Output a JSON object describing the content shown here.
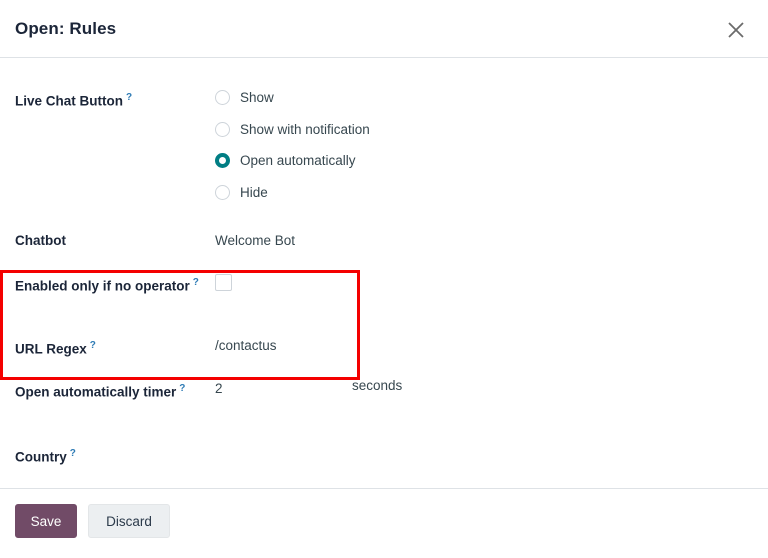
{
  "dialog": {
    "title": "Open: Rules",
    "close_icon": "close-icon"
  },
  "form": {
    "live_chat_button": {
      "label": "Live Chat Button",
      "help": "?",
      "options": [
        {
          "label": "Show",
          "selected": false
        },
        {
          "label": "Show with notification",
          "selected": false
        },
        {
          "label": "Open automatically",
          "selected": true
        },
        {
          "label": "Hide",
          "selected": false
        }
      ]
    },
    "chatbot": {
      "label": "Chatbot",
      "value": "Welcome Bot"
    },
    "enabled_only_if_no_operator": {
      "label": "Enabled only if no operator",
      "help": "?",
      "checked": false
    },
    "url_regex": {
      "label": "URL Regex",
      "help": "?",
      "value": "/contactus"
    },
    "open_automatically_timer": {
      "label": "Open automatically timer",
      "help": "?",
      "value": "2",
      "unit": "seconds"
    },
    "country": {
      "label": "Country",
      "help": "?",
      "value": ""
    }
  },
  "footer": {
    "save_label": "Save",
    "discard_label": "Discard"
  },
  "annotation": {
    "highlight_color": "#f40000"
  },
  "colors": {
    "primary": "#714b67",
    "accent_teal": "#017e84",
    "help_blue": "#2e7bb5",
    "text": "#37474f",
    "title": "#1b2538"
  }
}
